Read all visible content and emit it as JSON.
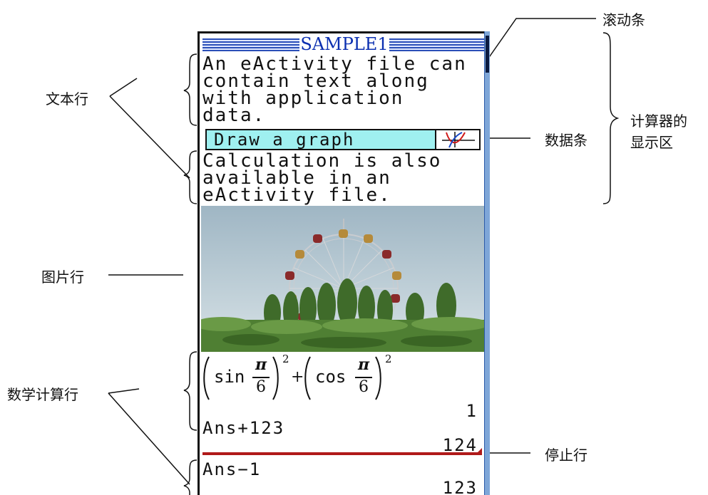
{
  "display": {
    "title": "SAMPLE1",
    "text_block_1": [
      "An eActivity file can",
      "contain text along",
      "with application",
      "data."
    ],
    "strip_label": "Draw a graph",
    "text_block_2": [
      "Calculation is also",
      "available in an",
      "eActivity file."
    ],
    "math_line_1": {
      "func_1": "sin",
      "func_2": "cos",
      "numerator": "π",
      "denominator": "6",
      "exponent": "2",
      "operator": "+",
      "result": "1"
    },
    "math_line_2": {
      "expression": "Ans+123",
      "result": "124"
    },
    "math_line_3": {
      "expression": "Ans−1",
      "result": "123"
    }
  },
  "callouts": {
    "scrollbar": "滚动条",
    "text_rows": "文本行",
    "data_strip": "数据条",
    "calculator_display": [
      "计算器的",
      "显示区"
    ],
    "picture_row": "图片行",
    "math_rows": "数学计算行",
    "stop_row": "停止行"
  },
  "colors": {
    "title_blue": "#0b2fb0",
    "strip_cyan": "#9ff0f0",
    "stop_line_red": "#b01a1a",
    "scrollbar_blue": "#7ea6d8"
  }
}
